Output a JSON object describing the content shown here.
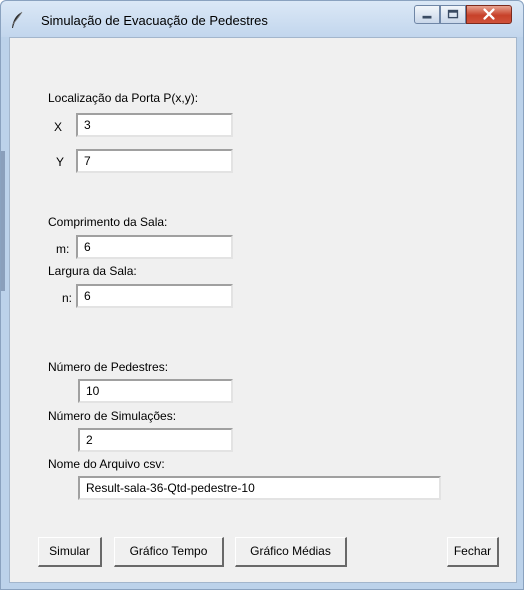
{
  "window": {
    "title": "Simulação de Evacuação de Pedestres",
    "icon": "feather-icon",
    "controls": [
      "minimize-icon",
      "maximize-icon",
      "close-icon"
    ]
  },
  "door": {
    "heading": "Localização da Porta P(x,y):",
    "x_label": "X",
    "x_value": "3",
    "y_label": "Y",
    "y_value": "7"
  },
  "room": {
    "length_heading": "Comprimento da Sala:",
    "m_label": "m:",
    "m_value": "6",
    "width_heading": "Largura da Sala:",
    "n_label": "n:",
    "n_value": "6"
  },
  "sim": {
    "pedestrians_label": "Número de Pedestres:",
    "pedestrians_value": "10",
    "simulations_label": "Número de Simulações:",
    "simulations_value": "2",
    "csv_label": "Nome do Arquivo csv:",
    "csv_value": "Result-sala-36-Qtd-pedestre-10"
  },
  "buttons": {
    "simulate": "Simular",
    "time_chart": "Gráfico Tempo",
    "mean_chart": "Gráfico Médias",
    "close": "Fechar"
  }
}
